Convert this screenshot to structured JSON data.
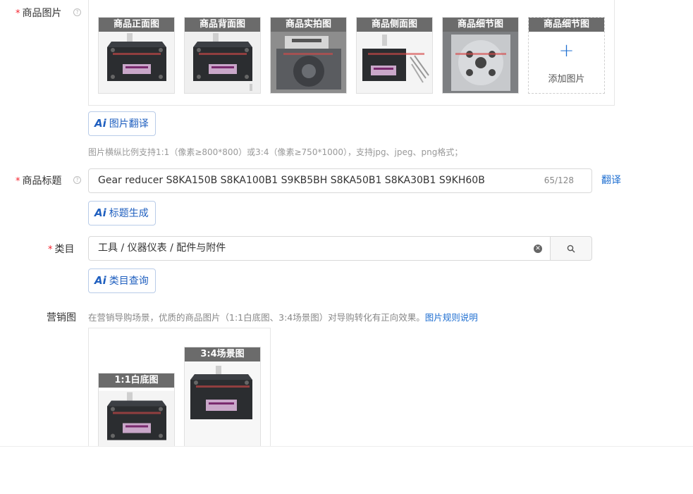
{
  "product_images": {
    "label": "商品图片",
    "required_mark": "*",
    "help": "?",
    "slots": [
      {
        "caption": "商品正面图"
      },
      {
        "caption": "商品背面图"
      },
      {
        "caption": "商品实拍图"
      },
      {
        "caption": "商品侧面图"
      },
      {
        "caption": "商品细节图"
      }
    ],
    "add_slot": {
      "caption": "商品细节图",
      "plus": "+",
      "label": "添加图片"
    },
    "ai_translate_label": "图片翻译",
    "hint": "图片横纵比例支持1:1（像素≥800*800）或3:4（像素≥750*1000），支持jpg、jpeg、png格式；"
  },
  "title_field": {
    "label": "商品标题",
    "required_mark": "*",
    "help": "?",
    "value": "Gear reducer S8KA150B S8KA100B1 S9KB5BH S8KA50B1 S8KA30B1 S9KH60B",
    "counter": "65/128",
    "translate_link": "翻译",
    "ai_generate_label": "标题生成"
  },
  "category_field": {
    "label": "类目",
    "required_mark": "*",
    "value": "工具 / 仪器仪表 / 配件与附件",
    "ai_query_label": "类目查询"
  },
  "marketing_field": {
    "label": "营销图",
    "hint": "在营销导购场景，优质的商品图片（1:1白底图、3:4场景图）对导购转化有正向效果。",
    "rules_link": "图片规则说明",
    "slots": [
      {
        "caption": "1:1白底图"
      },
      {
        "caption": "3:4场景图"
      }
    ]
  },
  "ai_badge": "Ai",
  "colors": {
    "accent": "#1f6fd1",
    "required": "#f5222d",
    "caption_bg": "#6b6b6b"
  }
}
